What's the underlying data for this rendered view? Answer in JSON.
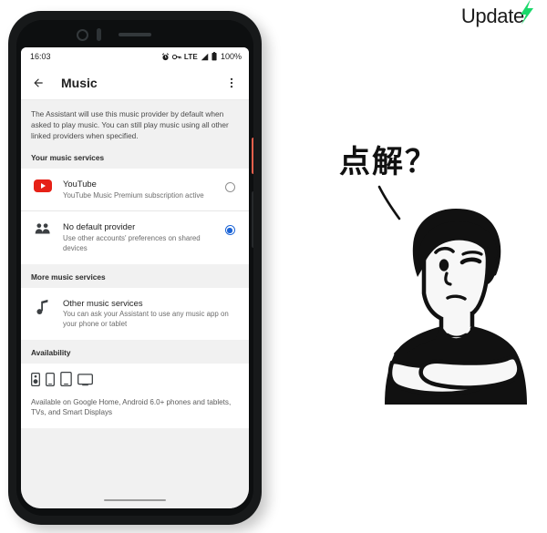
{
  "watermark": {
    "text": "Update",
    "accent_color": "#19d96a",
    "bolt_icon": "lightning-bolt-icon"
  },
  "annotation": {
    "question_text": "点解？"
  },
  "illustration": {
    "name": "skeptical-person-crossed-arms",
    "stroke_color": "#111111"
  },
  "phone": {
    "frame_color": "#17191a",
    "power_button_color": "#e8604c",
    "volume_button_color": "#26292b"
  },
  "status_bar": {
    "clock": "16:03",
    "battery_percent": "100%",
    "network_type": "LTE",
    "icons": [
      "alarm-icon",
      "vpn-key-icon",
      "signal-bars-icon",
      "battery-icon"
    ]
  },
  "app_bar": {
    "back_icon": "arrow-back-icon",
    "title": "Music",
    "overflow_icon": "more-vert-icon"
  },
  "content": {
    "description": "The Assistant will use this music provider by default when asked to play music. You can still play music using all other linked providers when specified.",
    "sections": [
      {
        "header": "Your music services",
        "rows": [
          {
            "icon": "youtube-icon",
            "title": "YouTube",
            "subtitle": "YouTube Music Premium subscription active",
            "selected": false
          },
          {
            "icon": "people-group-icon",
            "title": "No default provider",
            "subtitle": "Use other accounts' preferences on shared devices",
            "selected": true
          }
        ]
      },
      {
        "header": "More music services",
        "rows": [
          {
            "icon": "music-note-icon",
            "title": "Other music services",
            "subtitle": "You can ask your Assistant to use any music app on your phone or tablet",
            "selected": null
          }
        ]
      }
    ],
    "availability": {
      "header": "Availability",
      "device_icons": [
        "smart-speaker-icon",
        "phone-icon",
        "tablet-icon",
        "tv-icon"
      ],
      "text": "Available on Google Home, Android 6.0+ phones and tablets, TVs, and Smart Displays"
    }
  },
  "nav": {
    "gesture_pill": "home-gesture-pill"
  },
  "colors": {
    "selected_radio": "#1a63d6",
    "youtube_red": "#e62117",
    "screen_bg": "#f1f1f1",
    "card_bg": "#ffffff"
  }
}
